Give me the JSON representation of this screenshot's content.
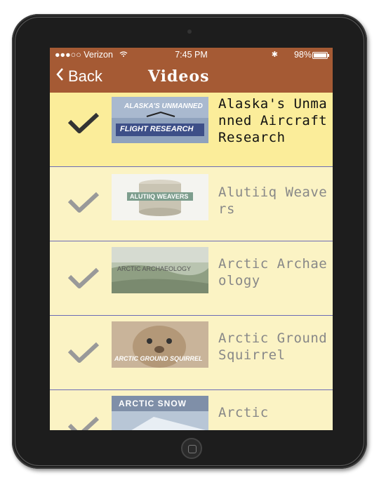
{
  "status": {
    "carrier": "●●●○○ Verizon",
    "time": "7:45 PM",
    "bluetooth": "✱",
    "battery": "98%"
  },
  "nav": {
    "back_label": "Back",
    "title": "Videos"
  },
  "videos": [
    {
      "title": "Alaska's Unmanned Aircraft Research",
      "thumb_text_top": "ALASKA'S UNMANNED",
      "thumb_text_bottom": "FLIGHT RESEARCH",
      "selected": true
    },
    {
      "title": "Alutiiq Weavers",
      "thumb_text_top": "ALUTIIQ WEAVERS",
      "selected": false
    },
    {
      "title": "Arctic Archaeology",
      "thumb_text_top": "ARCTIC ARCHAEOLOGY",
      "selected": false
    },
    {
      "title": "Arctic Ground Squirrel",
      "thumb_text_top": "ARCTIC GROUND SQUIRREL",
      "selected": false
    },
    {
      "title": "Arctic",
      "thumb_text_top": "ARCTIC SNOW",
      "selected": false
    }
  ],
  "colors": {
    "nav_bg": "#a55a34",
    "row_bg": "#fbf3c4",
    "row_selected_bg": "#fbed9a",
    "separator": "#6b6bb5"
  }
}
